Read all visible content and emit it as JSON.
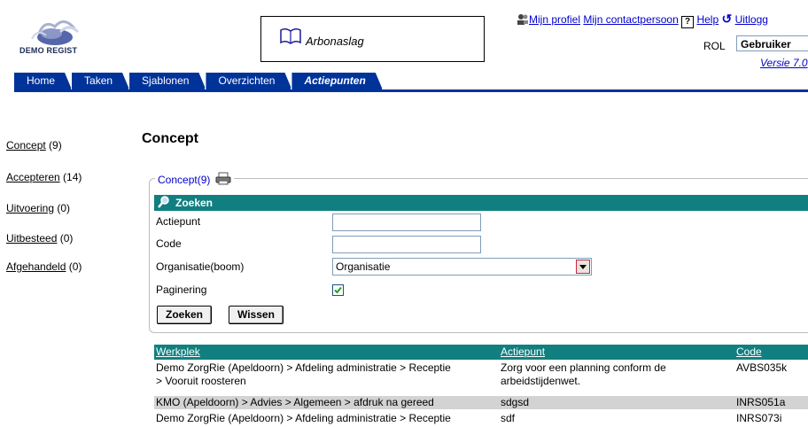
{
  "logo": {
    "text": "DEMO REGIST",
    "icon": "demo-regist-logo"
  },
  "banner": {
    "icon": "open-book-icon",
    "label": "Arbonaslag"
  },
  "toplinks": {
    "profile_icon": "users-icon",
    "profile": "Mijn profiel",
    "contact": "Mijn contactpersoon",
    "help_icon": "help-question-icon",
    "help": "Help",
    "logout_icon": "refresh-logout-icon",
    "logout": "Uitlogg"
  },
  "role": {
    "label": "ROL",
    "value": "Gebruiker"
  },
  "version": "Versie 7.0",
  "tabs": [
    "Home",
    "Taken",
    "Sjablonen",
    "Overzichten",
    "Actiepunten"
  ],
  "sidebar": [
    {
      "label": "Concept",
      "count": "(9)"
    },
    {
      "label": "Accepteren",
      "count": "(14)"
    },
    {
      "label": "Uitvoering",
      "count": "(0)"
    },
    {
      "label": "Uitbesteed",
      "count": "(0)"
    },
    {
      "label": "Afgehandeld",
      "count": "(0)"
    }
  ],
  "page_title": "Concept",
  "fieldset": {
    "legend": "Concept(9)",
    "print_icon": "printer-icon"
  },
  "search": {
    "header": "Zoeken",
    "header_icon": "search-magnifier-icon",
    "fields": {
      "actiepunt_label": "Actiepunt",
      "actiepunt_value": "",
      "code_label": "Code",
      "code_value": "",
      "organisatie_label": "Organisatie(boom)",
      "organisatie_value": "Organisatie",
      "paginering_label": "Paginering",
      "paginering_checked": true
    },
    "buttons": {
      "search": "Zoeken",
      "clear": "Wissen"
    }
  },
  "table": {
    "columns": [
      "Werkplek",
      "Actiepunt",
      "Code"
    ],
    "rows": [
      {
        "werkplek": "Demo ZorgRie (Apeldoorn) > Afdeling administratie > Receptie",
        "werkplek2": "> Vooruit roosteren",
        "actiepunt": "Zorg voor een planning conform de",
        "actiepunt2": "arbeidstijdenwet.",
        "code": "AVBS035k"
      },
      {
        "werkplek": "KMO (Apeldoorn) > Advies > Algemeen > afdruk na gereed",
        "actiepunt": "sdgsd",
        "code": "INRS051a"
      },
      {
        "werkplek": "Demo ZorgRie (Apeldoorn) > Afdeling administratie > Receptie",
        "actiepunt": "sdf",
        "code": "INRS073i"
      }
    ]
  },
  "colors": {
    "tab_blue": "#003399",
    "teal_header": "#117f7f",
    "link_blue": "#0000cc",
    "row_shade": "#d3d3d3"
  }
}
